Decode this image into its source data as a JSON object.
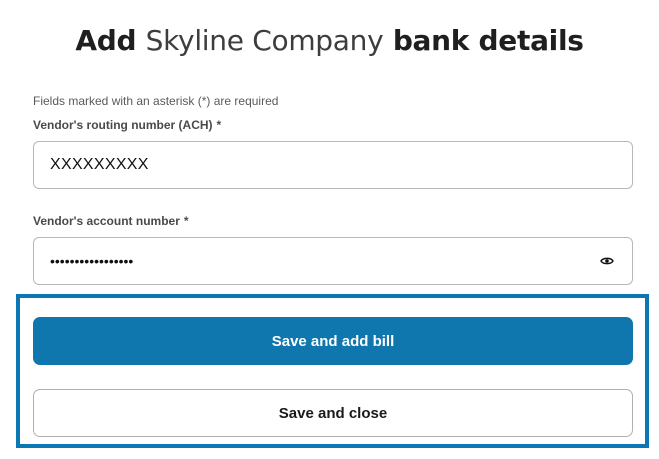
{
  "header": {
    "title_prefix": "Add",
    "company_name": "Skyline Company",
    "title_suffix": "bank details"
  },
  "form": {
    "required_note": "Fields marked with an asterisk (*) are required",
    "routing": {
      "label": "Vendor's routing number (ACH)",
      "asterisk": "*",
      "value": "XXXXXXXXX"
    },
    "account": {
      "label": "Vendor's account number",
      "asterisk": "*",
      "masked_value": "•••••••••••••••••",
      "toggle_icon": "eye-icon"
    }
  },
  "actions": {
    "primary_label": "Save and add bill",
    "secondary_label": "Save and close"
  },
  "colors": {
    "primary": "#1076ae",
    "highlight": "#0b78b3"
  }
}
